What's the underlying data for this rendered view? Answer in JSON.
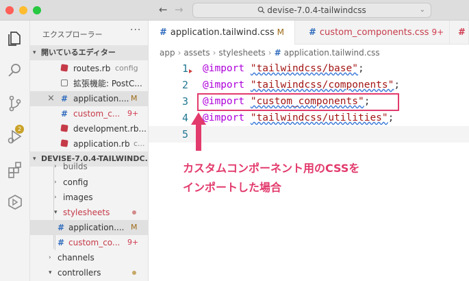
{
  "titlebar": {
    "search_text": "devise-7.0.4-tailwindcss",
    "nav_back": "←",
    "nav_forward": "→"
  },
  "activity": {
    "items": [
      "explorer",
      "search",
      "source-control",
      "run-and-debug",
      "extensions",
      "remote-explorer"
    ],
    "scm_badge": "2"
  },
  "sidebar": {
    "header": "エクスプローラー",
    "more": "···",
    "open_editors_section": "開いているエディター",
    "open_editors": [
      {
        "name": "routes.rb",
        "meta": "config"
      },
      {
        "name": "拡張機能: PostC...",
        "meta": ""
      },
      {
        "name": "application....",
        "badge": "M"
      },
      {
        "name": "custom_c...",
        "badge": "9+"
      },
      {
        "name": "development.rb...",
        "meta": ""
      },
      {
        "name": "application.rb",
        "meta": "c..."
      }
    ],
    "project_section": "DEVISE-7.0.4-TAILWINDC...",
    "tree": [
      {
        "name": "builds"
      },
      {
        "name": "config"
      },
      {
        "name": "images"
      },
      {
        "name": "stylesheets"
      },
      {
        "name": "application....",
        "badge": "M"
      },
      {
        "name": "custom_co...",
        "badge": "9+"
      },
      {
        "name": "channels"
      },
      {
        "name": "controllers"
      }
    ]
  },
  "tabs": [
    {
      "label": "application.tailwind.css",
      "badge": "M"
    },
    {
      "label": "custom_components.css",
      "badge": "9+"
    }
  ],
  "breadcrumb": {
    "parts": [
      "app",
      "assets",
      "stylesheets"
    ],
    "file": "application.tailwind.css"
  },
  "code": {
    "lines": [
      {
        "num": "1",
        "kw": "@import",
        "str": "\"tailwindcss/base\"",
        "end": ";"
      },
      {
        "num": "2",
        "kw": "@import",
        "str": "\"tailwindcss/components\"",
        "end": ";"
      },
      {
        "num": "3",
        "kw": "@import",
        "str": "\"custom_components\"",
        "end": ";"
      },
      {
        "num": "4",
        "kw": "@import",
        "str": "\"tailwindcss/utilities\"",
        "end": ";"
      },
      {
        "num": "5",
        "kw": "",
        "str": "",
        "end": ""
      }
    ]
  },
  "annotation": {
    "line1": "カスタムコンポーネント用のCSSを",
    "line2": "インポートした場合",
    "color": "#e23a6c"
  }
}
